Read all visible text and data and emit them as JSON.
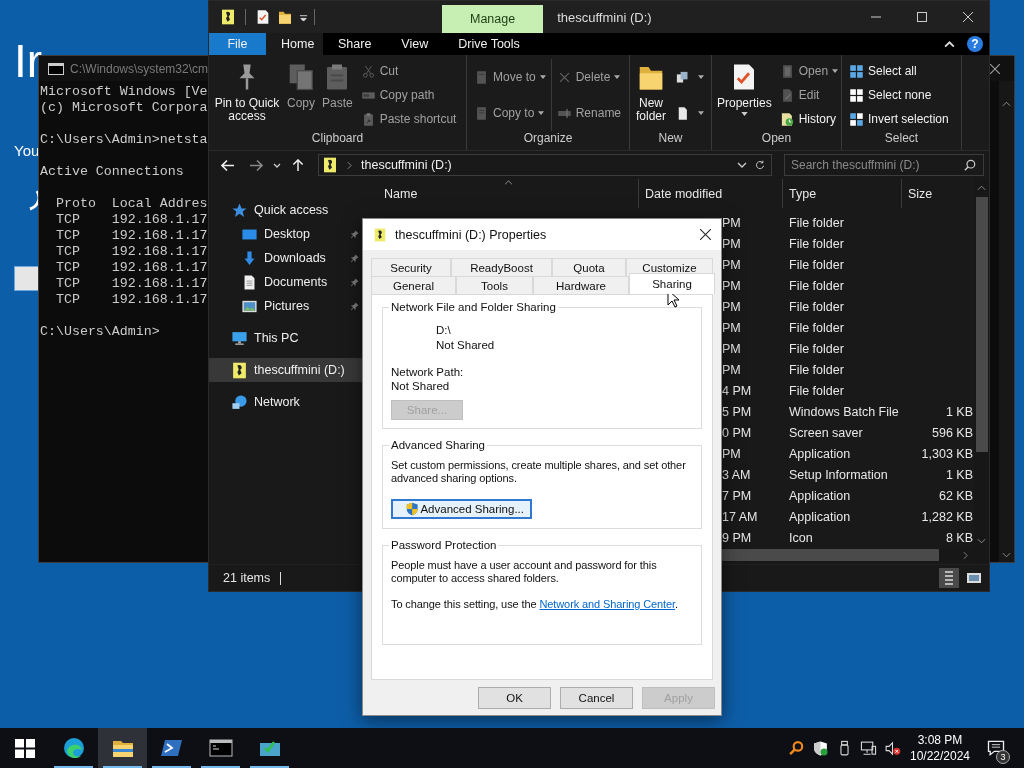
{
  "setup": {
    "heading": "Ir",
    "text": "You"
  },
  "console": {
    "title": "C:\\Windows\\system32\\cm",
    "blocks": [
      [
        "Microsoft Windows [Ve",
        "(c) Microsoft Corpora"
      ],
      [
        "C:\\Users\\Admin>netsta"
      ],
      [
        "Active Connections"
      ],
      [
        "  Proto  Local Addres",
        "  TCP    192.168.1.17",
        "  TCP    192.168.1.17",
        "  TCP    192.168.1.17",
        "  TCP    192.168.1.17",
        "  TCP    192.168.1.17",
        "  TCP    192.168.1.17"
      ],
      [
        "C:\\Users\\Admin>"
      ]
    ]
  },
  "explorer": {
    "context_tab": "Manage",
    "title": "thescuffmini (D:)",
    "ribbon_tabs": [
      {
        "label": "File",
        "kind": "file",
        "selected": false
      },
      {
        "label": "Home",
        "kind": "tab",
        "selected": true
      },
      {
        "label": "Share",
        "kind": "tab",
        "selected": false
      },
      {
        "label": "View",
        "kind": "tab",
        "selected": false
      },
      {
        "label": "Drive Tools",
        "kind": "tab",
        "selected": false
      }
    ],
    "help_label": "?",
    "ribbon_groups": [
      {
        "label": "Clipboard",
        "columns": [
          {
            "kind": "large",
            "items": [
              {
                "label": "Pin to Quick access",
                "kind": "pin",
                "disabled": false
              }
            ]
          },
          {
            "kind": "large",
            "items": [
              {
                "label": "Copy",
                "kind": "copy",
                "disabled": true
              }
            ]
          },
          {
            "kind": "large",
            "items": [
              {
                "label": "Paste",
                "kind": "paste",
                "disabled": true
              }
            ]
          },
          {
            "kind": "stack",
            "items": [
              {
                "label": "Cut",
                "kind": "cut",
                "disabled": true
              },
              {
                "label": "Copy path",
                "kind": "copypath",
                "disabled": true
              },
              {
                "label": "Paste shortcut",
                "kind": "shortcut",
                "disabled": true
              }
            ]
          }
        ]
      },
      {
        "label": "Organize",
        "columns": [
          {
            "kind": "stack",
            "items": [
              {
                "label": "Move to",
                "kind": "moveto",
                "disabled": true,
                "dropdown": true
              },
              {
                "label": "Copy to",
                "kind": "copyto",
                "disabled": true,
                "dropdown": true
              }
            ]
          },
          {
            "kind": "stack",
            "items": [
              {
                "label": "Delete",
                "kind": "delete",
                "disabled": true,
                "dropdown": true
              },
              {
                "label": "Rename",
                "kind": "rename",
                "disabled": true
              }
            ]
          }
        ]
      },
      {
        "label": "New",
        "columns": [
          {
            "kind": "large",
            "items": [
              {
                "label": "New folder",
                "kind": "newfolder",
                "disabled": false
              }
            ]
          },
          {
            "kind": "stack",
            "items": [
              {
                "kind": "newitem",
                "disabled": false,
                "dropdown": true
              },
              {
                "kind": "easyaccess",
                "disabled": false,
                "dropdown": true
              }
            ]
          }
        ]
      },
      {
        "label": "Open",
        "columns": [
          {
            "kind": "large",
            "items": [
              {
                "label": "Properties",
                "kind": "properties",
                "disabled": false,
                "dropdown": true
              }
            ]
          },
          {
            "kind": "stack",
            "items": [
              {
                "label": "Open",
                "kind": "open",
                "disabled": true,
                "dropdown": true
              },
              {
                "label": "Edit",
                "kind": "edit",
                "disabled": true
              },
              {
                "label": "History",
                "kind": "history",
                "disabled": false
              }
            ]
          }
        ]
      },
      {
        "label": "Select",
        "columns": [
          {
            "kind": "stack",
            "items": [
              {
                "label": "Select all",
                "kind": "selectall",
                "disabled": false
              },
              {
                "label": "Select none",
                "kind": "selectnone",
                "disabled": false
              },
              {
                "label": "Invert selection",
                "kind": "invert",
                "disabled": false
              }
            ]
          }
        ]
      }
    ],
    "address": {
      "path": "thescuffmini (D:)"
    },
    "search": {
      "placeholder": "Search thescuffmini (D:)"
    },
    "nav": [
      {
        "label": "Quick access",
        "kind": "star",
        "selected": false,
        "children": [
          {
            "label": "Desktop",
            "kind": "desktop",
            "pinned": true,
            "selected": false
          },
          {
            "label": "Downloads",
            "kind": "downloads",
            "pinned": true,
            "selected": false
          },
          {
            "label": "Documents",
            "kind": "documents",
            "pinned": true,
            "selected": false
          },
          {
            "label": "Pictures",
            "kind": "pictures",
            "pinned": true,
            "selected": false
          }
        ]
      },
      {
        "label": "This PC",
        "kind": "pc",
        "selected": false
      },
      {
        "label": "thescuffmini (D:)",
        "kind": "drive",
        "selected": true
      },
      {
        "label": "Network",
        "kind": "network",
        "selected": false
      }
    ],
    "columns": [
      {
        "label": "Name",
        "sorted": true
      },
      {
        "label": "Date modified",
        "sorted": false
      },
      {
        "label": "Type",
        "sorted": false
      },
      {
        "label": "Size",
        "sorted": false
      }
    ],
    "rows": [
      {
        "date": "PM",
        "type": "File folder"
      },
      {
        "date": "PM",
        "type": "File folder"
      },
      {
        "date": "PM",
        "type": "File folder"
      },
      {
        "date": "PM",
        "type": "File folder"
      },
      {
        "date": "PM",
        "type": "File folder"
      },
      {
        "date": "PM",
        "type": "File folder"
      },
      {
        "date": "PM",
        "type": "File folder"
      },
      {
        "date": "PM",
        "type": "File folder"
      },
      {
        "date": "4 PM",
        "type": "File folder"
      },
      {
        "date": "5 PM",
        "type": "Windows Batch File",
        "size": "1 KB"
      },
      {
        "date": "0 PM",
        "type": "Screen saver",
        "size": "596 KB"
      },
      {
        "date": "PM",
        "type": "Application",
        "size": "1,303 KB"
      },
      {
        "date": "3 AM",
        "type": "Setup Information",
        "size": "1 KB"
      },
      {
        "date": "7 PM",
        "type": "Application",
        "size": "62 KB"
      },
      {
        "date": "17 AM",
        "type": "Application",
        "size": "1,282 KB"
      },
      {
        "date": "9 PM",
        "type": "Icon",
        "size": "8 KB"
      }
    ],
    "status": "21 items",
    "view_buttons": [
      {
        "kind": "details",
        "selected": true
      },
      {
        "kind": "large_icons",
        "selected": false
      }
    ]
  },
  "dialog": {
    "title": "thescuffmini (D:) Properties",
    "tab_rows": [
      [
        {
          "label": "Security",
          "selected": false
        },
        {
          "label": "ReadyBoost",
          "selected": false
        },
        {
          "label": "Quota",
          "selected": false
        },
        {
          "label": "Customize",
          "selected": false
        }
      ],
      [
        {
          "label": "General",
          "selected": false
        },
        {
          "label": "Tools",
          "selected": false
        },
        {
          "label": "Hardware",
          "selected": false
        },
        {
          "label": "Sharing",
          "selected": true
        }
      ]
    ],
    "network_sharing": {
      "heading": "Network File and Folder Sharing",
      "drive": "D:\\",
      "drive_status": "Not Shared",
      "path_label": "Network Path:",
      "path_value": "Not Shared",
      "button": {
        "label": "Share...",
        "disabled": true
      }
    },
    "advanced": {
      "heading": "Advanced Sharing",
      "text": "Set custom permissions, create multiple shares, and set other advanced sharing options.",
      "button": {
        "label": "Advanced Sharing...",
        "focused": true
      }
    },
    "password": {
      "heading": "Password Protection",
      "text": "People must have a user account and password for this computer to access shared folders.",
      "link_prefix": "To change this setting, use the ",
      "link": "Network and Sharing Center",
      "link_suffix": "."
    },
    "buttons": [
      {
        "label": "OK",
        "disabled": false
      },
      {
        "label": "Cancel",
        "disabled": false
      },
      {
        "label": "Apply",
        "disabled": true
      }
    ]
  },
  "taskbar": {
    "apps": [
      {
        "kind": "edge",
        "running": true,
        "active": false
      },
      {
        "kind": "explorer",
        "running": true,
        "active": true
      },
      {
        "kind": "powershell",
        "running": true,
        "active": false
      },
      {
        "kind": "cmd",
        "running": true,
        "active": false
      },
      {
        "kind": "app",
        "running": true,
        "active": false
      }
    ],
    "tray": [
      {
        "kind": "magnifier"
      },
      {
        "kind": "shield"
      },
      {
        "kind": "usb"
      },
      {
        "kind": "network"
      },
      {
        "kind": "muted"
      }
    ],
    "time": "3:08 PM",
    "date": "10/22/2024",
    "notifications": "3"
  }
}
